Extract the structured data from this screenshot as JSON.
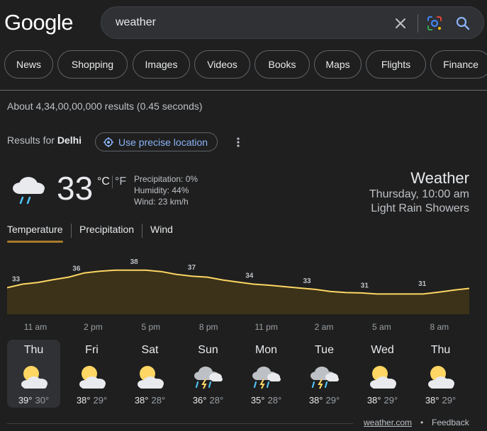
{
  "header": {
    "logo": "Google",
    "query": "weather",
    "icons": [
      "close-icon",
      "lens-icon",
      "search-icon"
    ]
  },
  "tabs": [
    "News",
    "Shopping",
    "Images",
    "Videos",
    "Books",
    "Maps",
    "Flights",
    "Finance"
  ],
  "stats": "About 4,34,00,00,000 results (0.45 seconds)",
  "location": {
    "prefix": "Results for ",
    "city": "Delhi",
    "precise_label": "Use precise location"
  },
  "current": {
    "temp": "33",
    "unit_c": "°C",
    "unit_f": "°F",
    "precipitation": "Precipitation: 0%",
    "humidity": "Humidity: 44%",
    "wind": "Wind: 23 km/h",
    "title": "Weather",
    "time": "Thursday, 10:00 am",
    "condition": "Light Rain Showers",
    "icon": "rain-cloud-icon"
  },
  "weather_tabs": [
    "Temperature",
    "Precipitation",
    "Wind"
  ],
  "hourly": {
    "times": [
      "11 am",
      "2 pm",
      "5 pm",
      "8 pm",
      "11 pm",
      "2 am",
      "5 am",
      "8 am"
    ],
    "labels": [
      "33",
      "36",
      "38",
      "37",
      "34",
      "33",
      "31",
      "31"
    ],
    "curve": [
      33,
      34,
      34.5,
      35.3,
      36,
      37.2,
      37.7,
      38,
      38,
      38,
      37.6,
      36.8,
      36.3,
      36,
      35.2,
      34.6,
      34,
      33.7,
      33.3,
      32.9,
      32.5,
      31.9,
      31.6,
      31.5,
      31.2,
      31.2,
      31.2,
      31.2,
      31.7,
      32.3,
      32.8
    ]
  },
  "colors": {
    "line": "#fdd663",
    "fill": "#3b3219",
    "tab_underline": "#a87c2a",
    "accent_link": "#8ab4f8"
  },
  "days": [
    {
      "name": "Thu",
      "hi": "39°",
      "lo": "30°",
      "icon": "partly-cloudy-icon"
    },
    {
      "name": "Fri",
      "hi": "38°",
      "lo": "29°",
      "icon": "partly-cloudy-icon"
    },
    {
      "name": "Sat",
      "hi": "38°",
      "lo": "28°",
      "icon": "partly-cloudy-icon"
    },
    {
      "name": "Sun",
      "hi": "36°",
      "lo": "28°",
      "icon": "thunder-rain-icon"
    },
    {
      "name": "Mon",
      "hi": "35°",
      "lo": "28°",
      "icon": "thunder-rain-icon"
    },
    {
      "name": "Tue",
      "hi": "38°",
      "lo": "29°",
      "icon": "thunder-rain-icon"
    },
    {
      "name": "Wed",
      "hi": "38°",
      "lo": "29°",
      "icon": "partly-cloudy-icon"
    },
    {
      "name": "Thu",
      "hi": "38°",
      "lo": "29°",
      "icon": "partly-cloudy-icon"
    }
  ],
  "footer": {
    "source": "weather.com",
    "dot": "•",
    "feedback": "Feedback"
  }
}
